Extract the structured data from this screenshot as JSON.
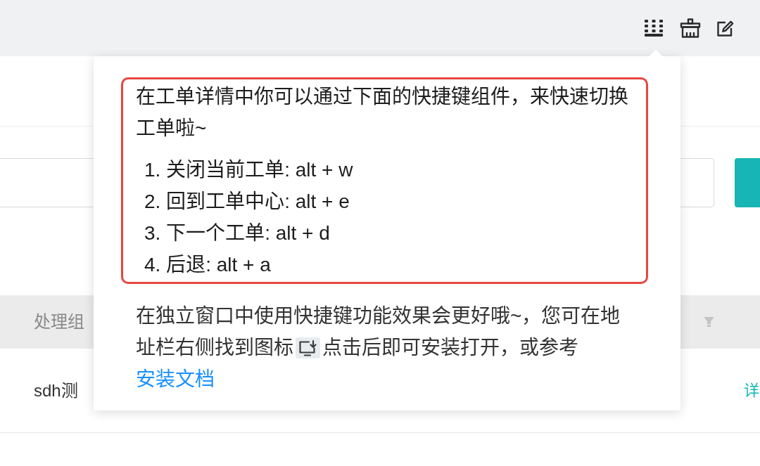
{
  "table": {
    "columns": [
      "处理组"
    ],
    "rows": [
      {
        "cells": [
          "sdh测"
        ],
        "link": "详"
      }
    ]
  },
  "popover": {
    "intro": "在工单详情中你可以通过下面的快捷键组件，来快速切换工单啦~",
    "shortcuts": [
      "1. 关闭当前工单: alt + w",
      "2. 回到工单中心: alt + e",
      "3. 下一个工单: alt + d",
      "4. 后退: alt + a"
    ],
    "note": {
      "text_before_icon": "在独立窗口中使用快捷键功能效果会更好哦~，您可在地址栏右侧找到图标",
      "text_after_icon": "点击后即可安装打开，或参考 ",
      "link": "安装文档"
    }
  }
}
